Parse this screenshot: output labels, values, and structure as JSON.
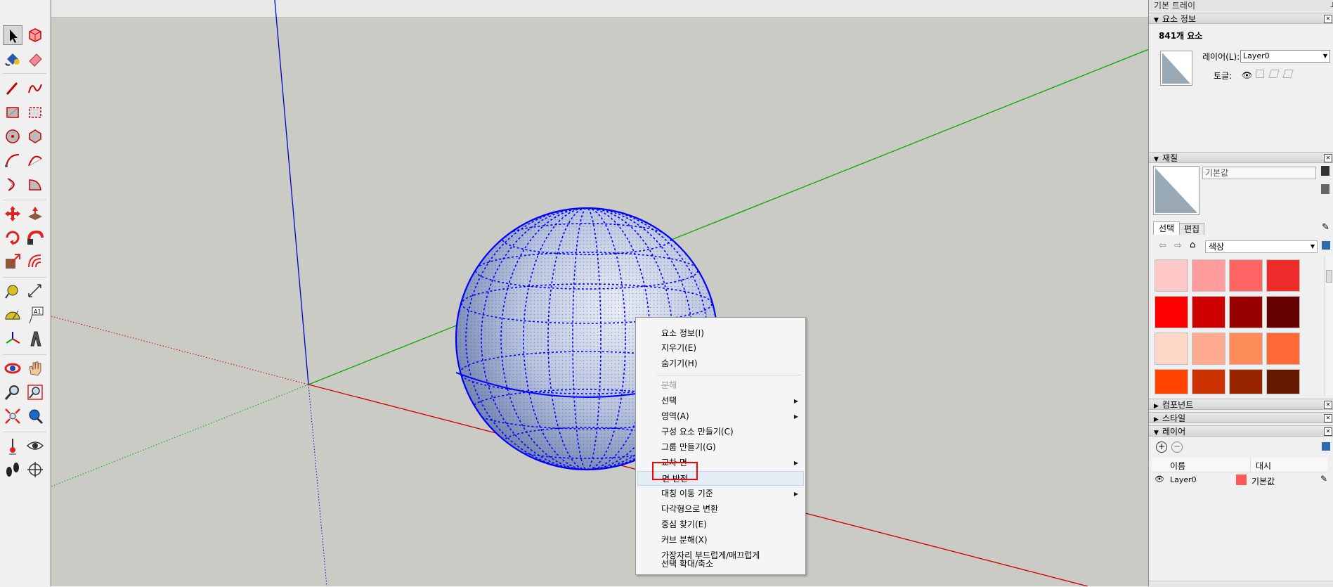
{
  "tray": {
    "title": "기본 트레이",
    "entity_info": {
      "header": "요소 정보",
      "count": "841개 요소",
      "layer_label": "레이어(L):",
      "layer_value": "Layer0",
      "toggle_label": "토글:"
    },
    "materials": {
      "header": "재질",
      "name_placeholder": "기본값",
      "tabs": [
        "선택",
        "편집"
      ],
      "library": "색상",
      "swatches": [
        "#ffc8c8",
        "#ff9c9c",
        "#ff6464",
        "#ee2b2b",
        "#ff0000",
        "#cc0000",
        "#990000",
        "#650000",
        "#ffd7c8",
        "#ffab90",
        "#ff8c5a",
        "#ff6a36",
        "#ff4400",
        "#cc3300",
        "#992400",
        "#661800"
      ]
    },
    "components": {
      "header": "컴포넌트"
    },
    "styles": {
      "header": "스타일"
    },
    "layers": {
      "header": "레이어",
      "col_name": "이름",
      "col_style": "대시",
      "rows": [
        {
          "name": "Layer0",
          "color": "#ff5a5a",
          "dash": "기본값"
        }
      ]
    }
  },
  "context_menu": {
    "items": [
      {
        "label": "요소 정보(I)"
      },
      {
        "label": "지우기(E)"
      },
      {
        "label": "숨기기(H)"
      },
      {
        "label": "분해",
        "disabled": true
      },
      {
        "label": "선택",
        "submenu": true
      },
      {
        "label": "영역(A)",
        "submenu": true
      },
      {
        "label": "구성 요소 만들기(C)"
      },
      {
        "label": "그룹 만들기(G)"
      },
      {
        "label": "교차 면",
        "submenu": true
      },
      {
        "label": "면 반전",
        "highlighted": true
      },
      {
        "label": "대칭 이동 기준",
        "submenu": true
      },
      {
        "label": "다각형으로 변환"
      },
      {
        "label": "중심 찾기(E)"
      },
      {
        "label": "커브 분해(X)"
      },
      {
        "label": "가장자리 부드럽게/매끄럽게"
      },
      {
        "label": "선택 확대/축소"
      }
    ],
    "submenu_arrow": "▶"
  },
  "colors": {
    "axis_blue": "#0000cc",
    "axis_green": "#00aa00",
    "axis_red": "#cc0000",
    "sphere_fill": "#b9c4df",
    "sphere_edge": "#0000ff",
    "viewport_bg": "#cbcbc6"
  }
}
